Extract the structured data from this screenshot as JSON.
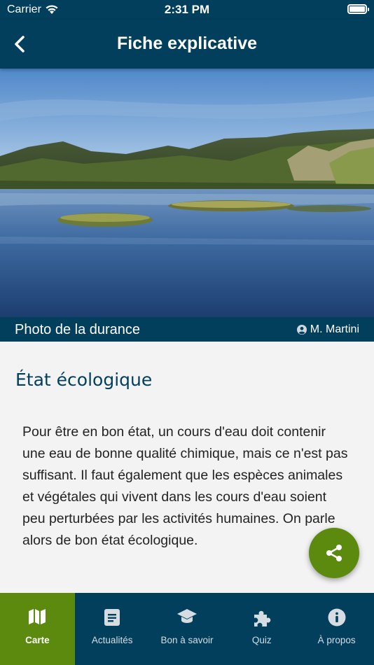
{
  "status": {
    "carrier": "Carrier",
    "time": "2:31 PM"
  },
  "nav": {
    "title": "Fiche explicative",
    "back_icon": "chevron-left-icon"
  },
  "photo": {
    "caption": "Photo de la durance",
    "credit": "M. Martini"
  },
  "section": {
    "title": "État écologique",
    "text": "Pour être en bon état, un cours d'eau doit contenir une eau de bonne qualité chimique, mais ce n'est pas suffisant. Il faut également que les espèces animales et végétales qui vivent dans les cours d'eau soient peu perturbées par les activités humaines. On parle alors de bon état écologique."
  },
  "fab": {
    "icon": "share-icon"
  },
  "tabs": [
    {
      "label": "Carte",
      "icon": "map-icon",
      "active": true
    },
    {
      "label": "Actualités",
      "icon": "document-icon",
      "active": false
    },
    {
      "label": "Bon à savoir",
      "icon": "graduation-cap-icon",
      "active": false
    },
    {
      "label": "Quiz",
      "icon": "puzzle-icon",
      "active": false
    },
    {
      "label": "À propos",
      "icon": "info-icon",
      "active": false
    }
  ],
  "colors": {
    "primary": "#023f5c",
    "accent": "#5c8a0f",
    "background": "#f3f3f3"
  }
}
